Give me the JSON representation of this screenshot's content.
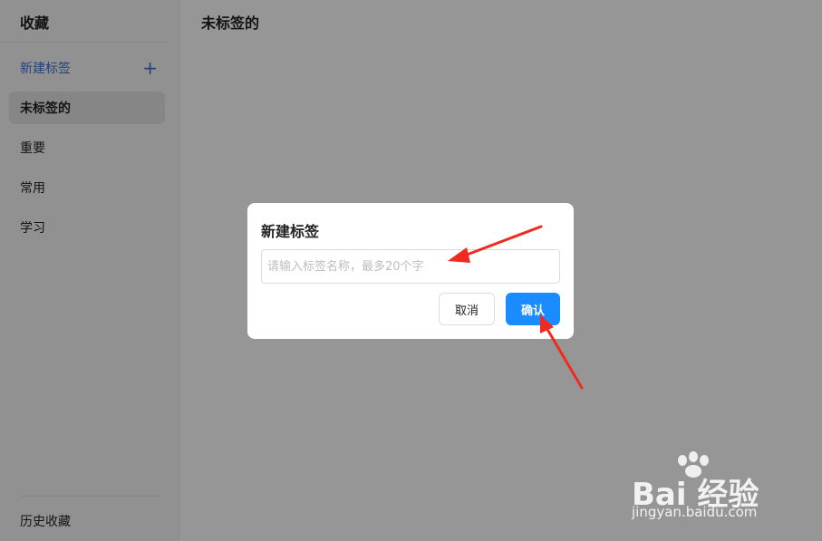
{
  "sidebar": {
    "title": "收藏",
    "new_tag_label": "新建标签",
    "new_tag_icon": "plus-icon",
    "tags": [
      {
        "label": "未标签的",
        "active": true
      },
      {
        "label": "重要",
        "active": false
      },
      {
        "label": "常用",
        "active": false
      },
      {
        "label": "学习",
        "active": false
      }
    ],
    "history_label": "历史收藏"
  },
  "main": {
    "title": "未标签的"
  },
  "dialog": {
    "title": "新建标签",
    "input": {
      "value": "",
      "placeholder": "请输入标签名称，最多20个字"
    },
    "cancel_label": "取消",
    "confirm_label": "确认"
  },
  "watermark": {
    "logo_text": "Bai  经验",
    "url_text": "jingyan.baidu.com"
  },
  "colors": {
    "accent": "#1a8cff",
    "link": "#3a6fd6",
    "annotation_arrow": "#f02a1e",
    "overlay": "rgba(0,0,0,0.41)"
  }
}
